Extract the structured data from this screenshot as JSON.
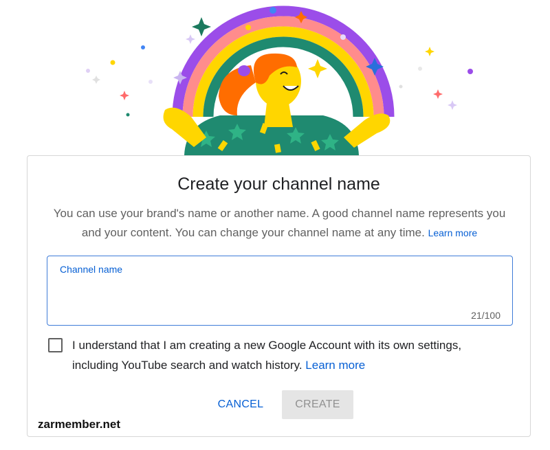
{
  "dialog": {
    "title": "Create your channel name",
    "description": "You can use your brand's name or another name. A good channel name represents you and your content. You can change your channel name at any time.",
    "description_learn_more": "Learn more",
    "field": {
      "label": "Channel name",
      "value": "",
      "counter": "21/100"
    },
    "acknowledgement": {
      "checked": false,
      "text": "I understand that I am creating a new Google Account with its own settings, including YouTube search and watch history.",
      "learn_more": "Learn more"
    },
    "buttons": {
      "cancel": "CANCEL",
      "create": "CREATE"
    }
  },
  "watermark": "zarmember.net",
  "colors": {
    "accent": "#065fd4",
    "field_border": "#3d7bd8",
    "disabled_bg": "#e5e5e5",
    "disabled_text": "#909090"
  }
}
